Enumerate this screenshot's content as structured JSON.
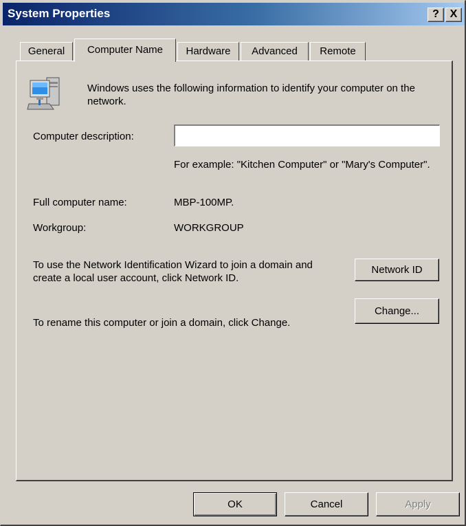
{
  "window": {
    "title": "System Properties"
  },
  "titlebar": {
    "help_label": "?",
    "close_label": "X"
  },
  "tabs": [
    {
      "label": "General"
    },
    {
      "label": "Computer Name"
    },
    {
      "label": "Hardware"
    },
    {
      "label": "Advanced"
    },
    {
      "label": "Remote"
    }
  ],
  "panel": {
    "intro": "Windows uses the following information to identify your computer on the network.",
    "description_label": "Computer description:",
    "description_value": "",
    "example_hint": "For example: \"Kitchen Computer\" or \"Mary's Computer\".",
    "full_name_label": "Full computer name:",
    "full_name_value": "MBP-100MP.",
    "workgroup_label": "Workgroup:",
    "workgroup_value": "WORKGROUP",
    "network_id_text": "To use the Network Identification Wizard to join a domain and create a local user account, click Network ID.",
    "network_id_button": "Network ID",
    "rename_text": "To rename this computer or join a domain, click Change.",
    "change_button": "Change..."
  },
  "footer": {
    "ok": "OK",
    "cancel": "Cancel",
    "apply": "Apply"
  }
}
